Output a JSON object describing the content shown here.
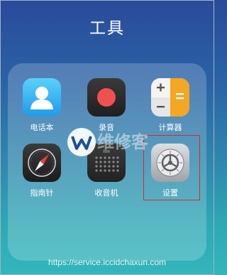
{
  "folder": {
    "title": "工具"
  },
  "apps": [
    {
      "label": "电话本",
      "icon": "contacts-icon"
    },
    {
      "label": "录音",
      "icon": "recorder-icon"
    },
    {
      "label": "计算器",
      "icon": "calculator-icon"
    },
    {
      "label": "指南针",
      "icon": "compass-icon"
    },
    {
      "label": "收音机",
      "icon": "radio-icon"
    },
    {
      "label": "设置",
      "icon": "gear-icon"
    }
  ],
  "watermark": {
    "text": "维修客",
    "source_url": "https://service.iccidchaxun.com"
  },
  "colors": {
    "highlight": "#d8282f",
    "recorder_dot": "#f0504f",
    "calculator_orange": "#f5a623"
  }
}
